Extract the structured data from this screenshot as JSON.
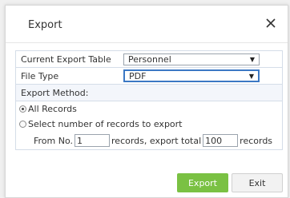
{
  "dialog": {
    "title": "Export",
    "close_icon": "close-icon"
  },
  "form": {
    "current_table_label": "Current Export Table",
    "current_table_value": "Personnel",
    "file_type_label": "File Type",
    "file_type_value": "PDF",
    "export_method_label": "Export Method:",
    "option_all": "All Records",
    "option_select": "Select number of records to export",
    "from_label": "From No.",
    "from_value": "1",
    "mid_label": "records, export total",
    "total_value": "100",
    "end_label": "records",
    "selected_option": "All Records"
  },
  "buttons": {
    "export_label": "Export",
    "exit_label": "Exit"
  },
  "colors": {
    "export_button": "#7ac143",
    "focus_border": "#3b78c4"
  }
}
